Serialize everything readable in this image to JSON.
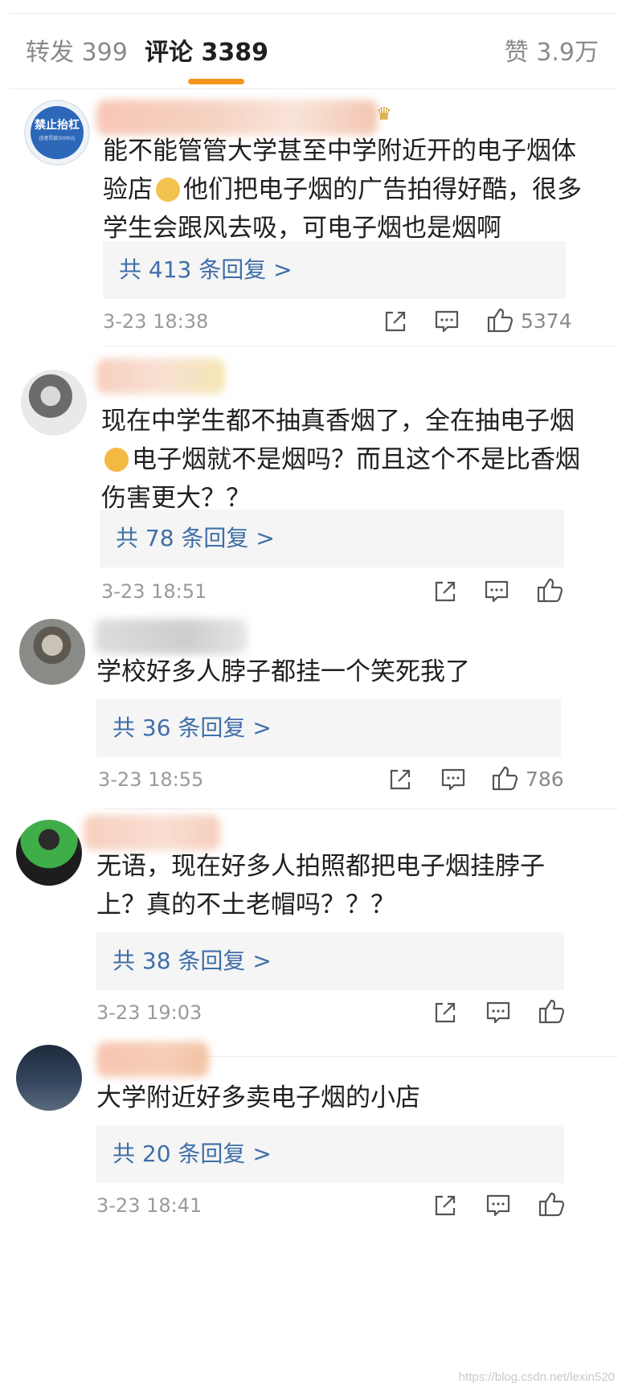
{
  "tabs": {
    "repost_label": "转发",
    "repost_count": "399",
    "comment_label": "评论",
    "comment_count": "3389",
    "like_label": "赞",
    "like_count": "3.9万"
  },
  "avatar1_sign": {
    "line1": "禁止抬杠",
    "line2": "违者罚款5000元"
  },
  "comments": [
    {
      "text_a": "能不能管管大学甚至中学附近开的电子烟体验店",
      "text_b": "他们把电子烟的广告拍得好酷，很多学生会跟风去吸，可电子烟也是烟啊",
      "replies": "共 413 条回复 >",
      "time": "3-23 18:38",
      "likes": "5374"
    },
    {
      "text_a": "现在中学生都不抽真香烟了，全在抽电子烟",
      "text_b": "电子烟就不是烟吗？而且这个不是比香烟伤害更大？？",
      "replies": "共 78 条回复 >",
      "time": "3-23 18:51",
      "likes": ""
    },
    {
      "text": "学校好多人脖子都挂一个笑死我了",
      "replies": "共 36 条回复 >",
      "time": "3-23 18:55",
      "likes": "786"
    },
    {
      "text": "无语，现在好多人拍照都把电子烟挂脖子上？真的不土老帽吗？？？",
      "replies": "共 38 条回复 >",
      "time": "3-23 19:03",
      "likes": ""
    },
    {
      "text": "大学附近好多卖电子烟的小店",
      "replies": "共 20 条回复 >",
      "time": "3-23 18:41",
      "likes": ""
    }
  ],
  "icons": {
    "share": "share-icon",
    "comment": "comment-icon",
    "like": "thumbs-up-icon"
  },
  "colors": {
    "accent": "#f6951f",
    "reply_link": "#3f6ea8",
    "reply_bg": "#f5f5f5"
  },
  "watermark": "https://blog.csdn.net/lexin520"
}
